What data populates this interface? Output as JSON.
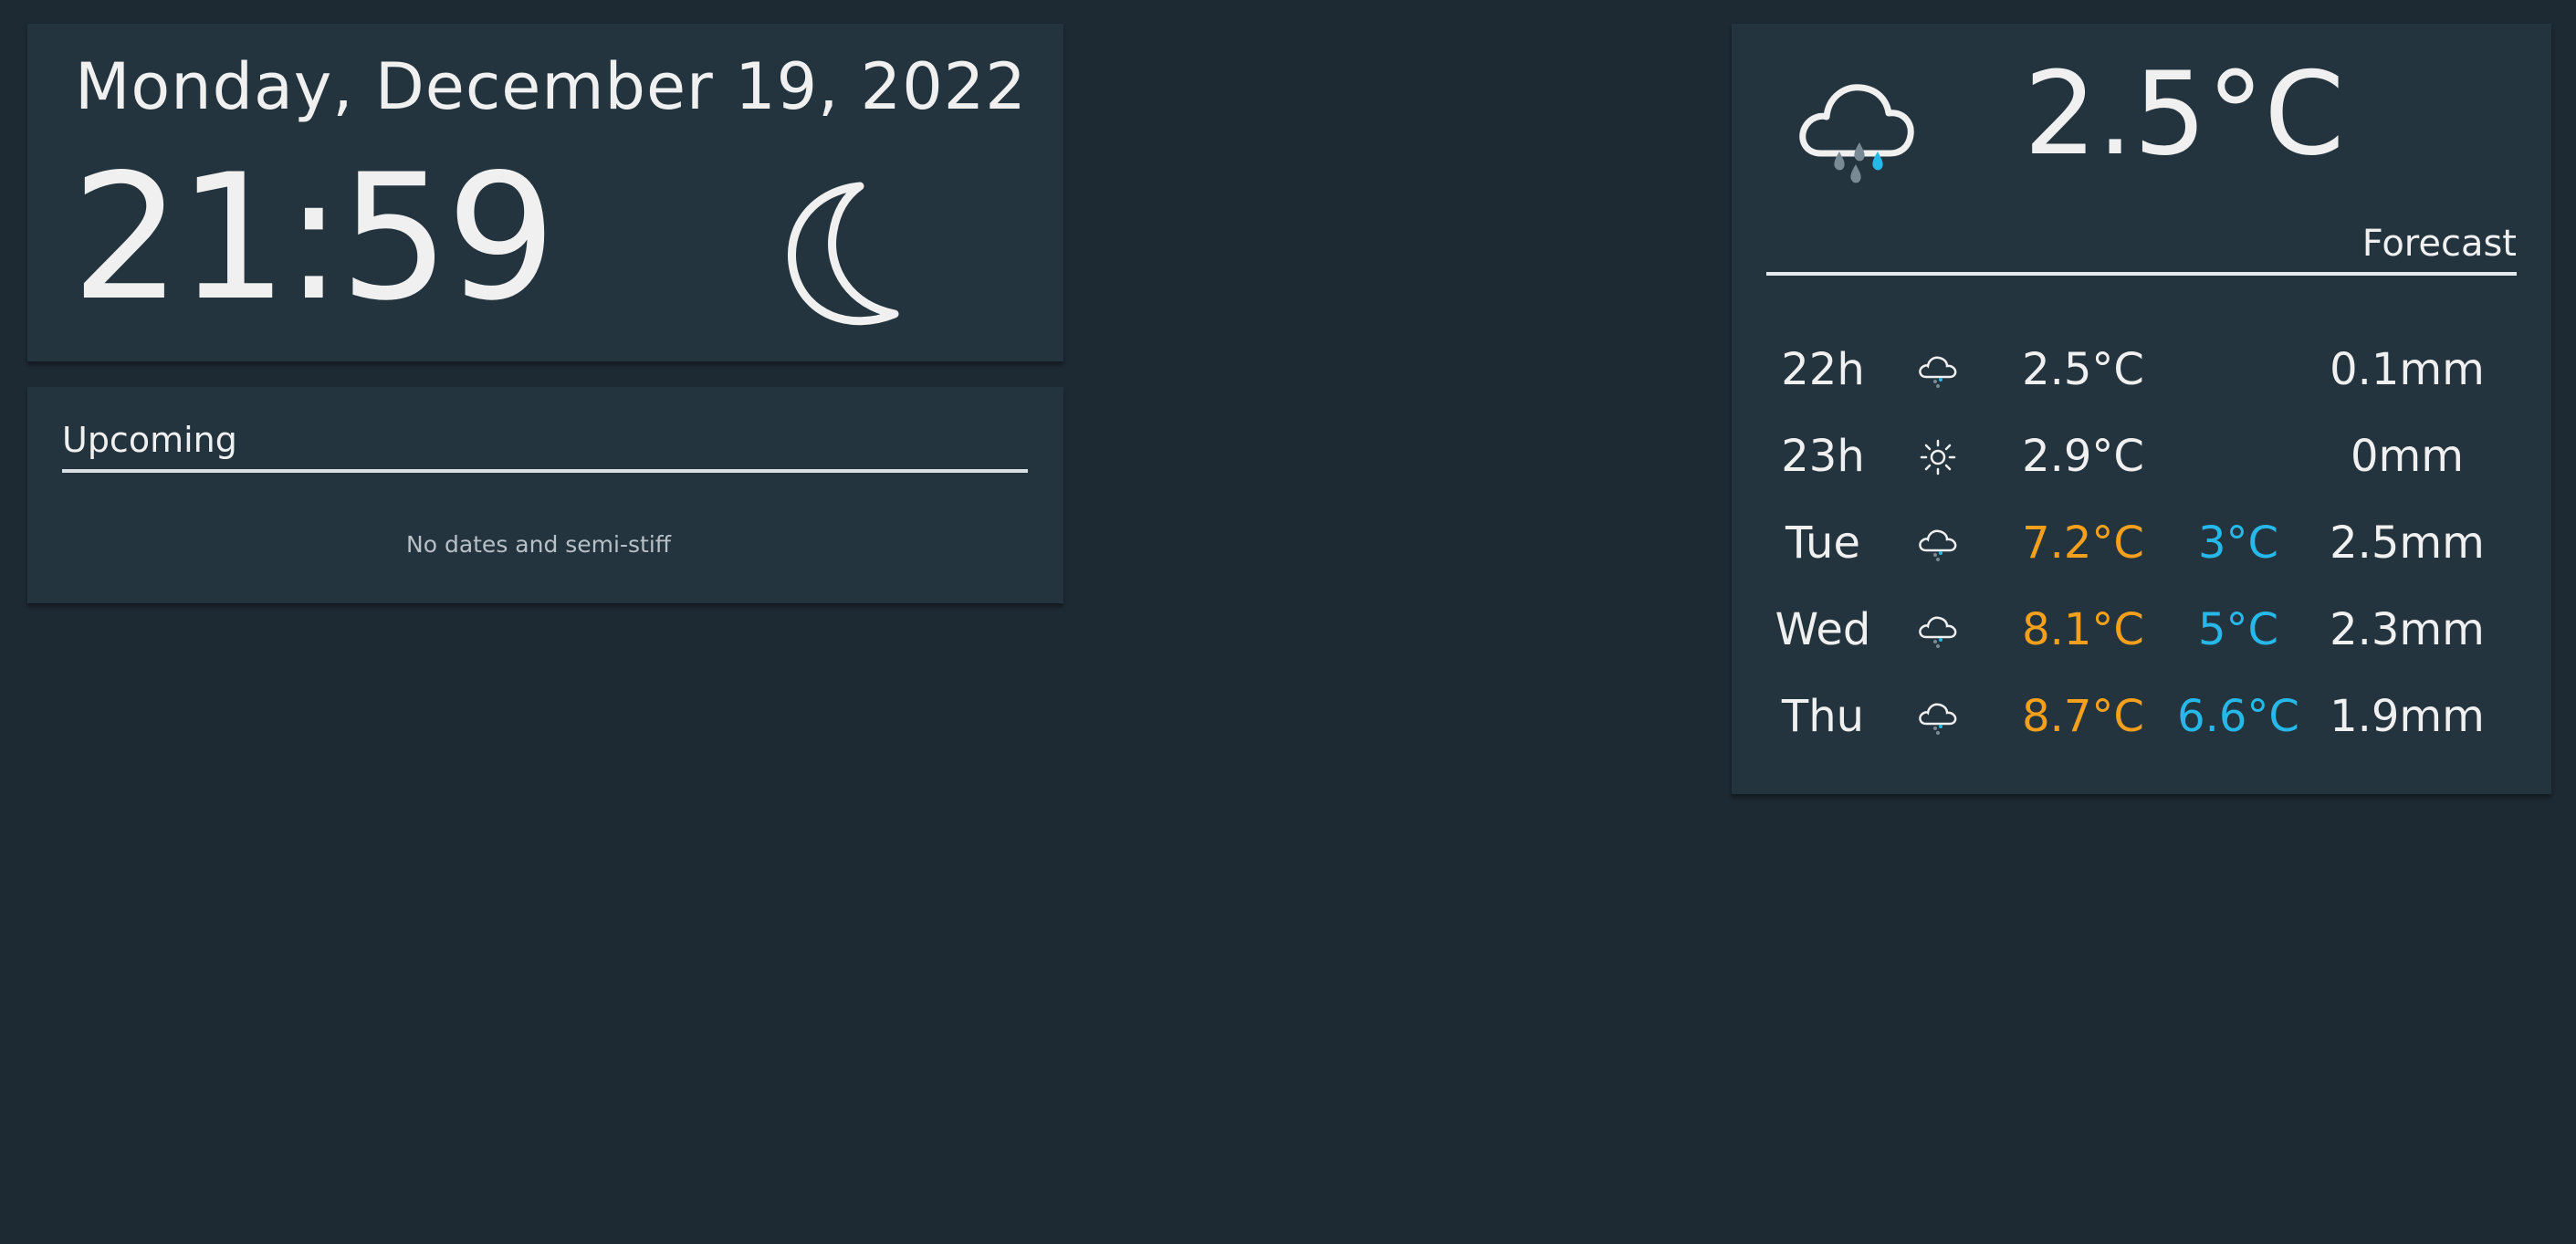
{
  "clock": {
    "date": "Monday, December 19, 2022",
    "time": "21:59",
    "icon": "moon-icon"
  },
  "upcoming": {
    "title": "Upcoming",
    "empty_message": "No dates and semi-stiff"
  },
  "weather": {
    "current_icon": "cloud-rain-icon",
    "current_temp": "2.5°C",
    "forecast_label": "Forecast",
    "colors": {
      "max": "#f4a01c",
      "min": "#26b8e8"
    },
    "forecast": [
      {
        "day": "22h",
        "icon": "cloud-rain-icon",
        "max": "2.5°C",
        "min": "",
        "rain": "0.1mm"
      },
      {
        "day": "23h",
        "icon": "sun-icon",
        "max": "2.9°C",
        "min": "",
        "rain": "0mm"
      },
      {
        "day": "Tue",
        "icon": "cloud-rain-icon",
        "max": "7.2°C",
        "min": "3°C",
        "rain": "2.5mm"
      },
      {
        "day": "Wed",
        "icon": "cloud-rain-icon",
        "max": "8.1°C",
        "min": "5°C",
        "rain": "2.3mm"
      },
      {
        "day": "Thu",
        "icon": "cloud-rain-icon",
        "max": "8.7°C",
        "min": "6.6°C",
        "rain": "1.9mm"
      }
    ]
  }
}
